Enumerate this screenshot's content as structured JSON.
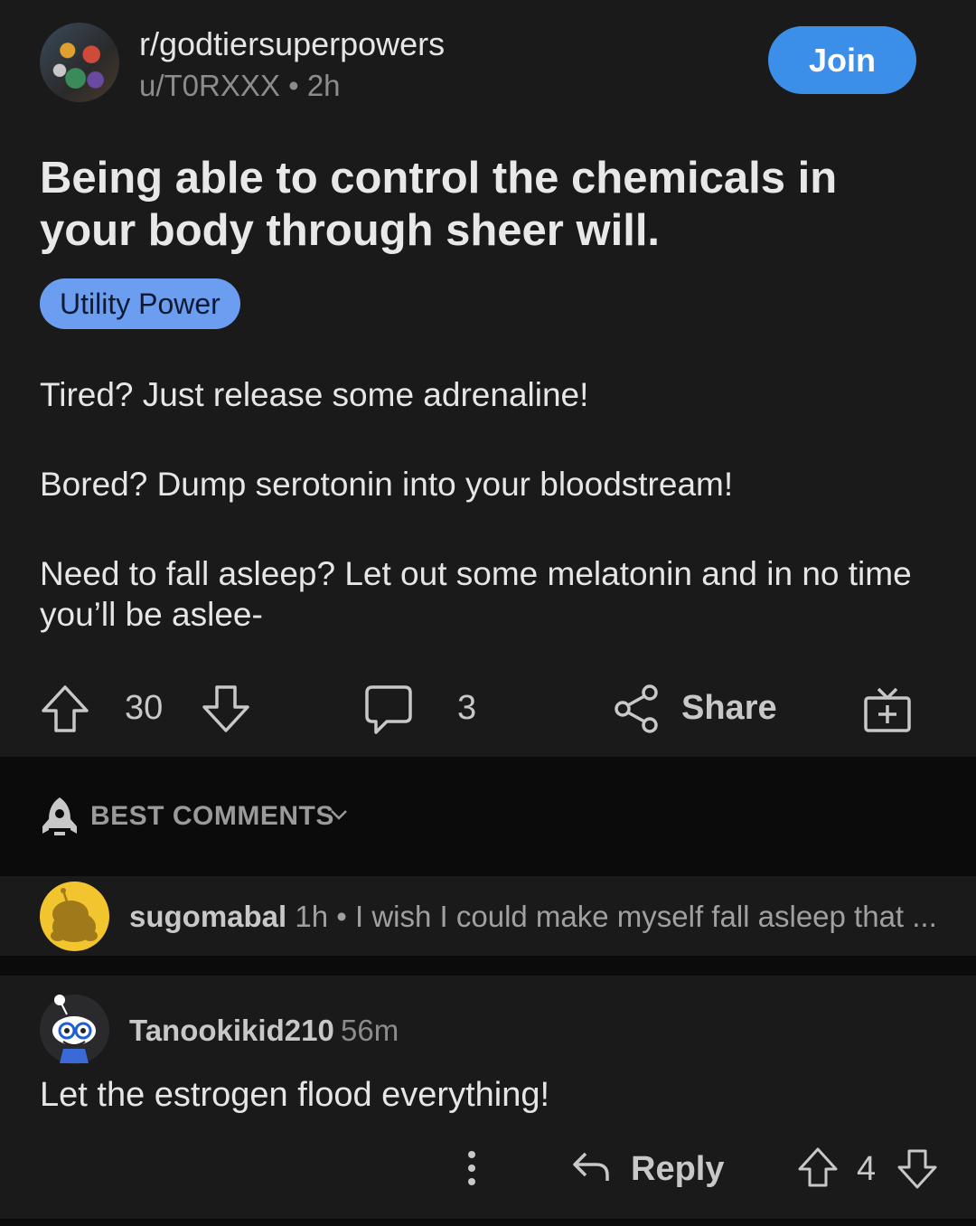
{
  "post": {
    "subreddit": "r/godtiersuperpowers",
    "author": "u/T0RXXX",
    "separator": "•",
    "age": "2h",
    "join_label": "Join",
    "title": "Being able to control the chemicals in your body through sheer will.",
    "flair": "Utility Power",
    "body": [
      "Tired? Just release some adrenaline!",
      "Bored? Dump serotonin into your bloodstream!",
      "Need to fall asleep? Let out some melatonin and in no time you’ll be aslee-"
    ],
    "upvotes": "30",
    "comments": "3",
    "share_label": "Share"
  },
  "sort": {
    "label": "BEST COMMENTS"
  },
  "collapsed_comment": {
    "user": "sugomabal",
    "age": "1h",
    "separator": "•",
    "preview": "I wish I could make myself fall asleep that ..."
  },
  "comment": {
    "user": "Tanookikid210",
    "age": "56m",
    "body": "Let the estrogen flood everything!",
    "reply_label": "Reply",
    "votes": "4"
  },
  "icons": [
    "subreddit-avatar",
    "upvote-icon",
    "downvote-icon",
    "comment-icon",
    "share-icon",
    "award-icon",
    "rocket-icon",
    "chevron-down-icon",
    "snoo-avatar",
    "more-icon",
    "reply-icon"
  ],
  "colors": {
    "accent": "#3b8fe8",
    "flair": "#6b9df0",
    "background": "#1a1a1b"
  }
}
